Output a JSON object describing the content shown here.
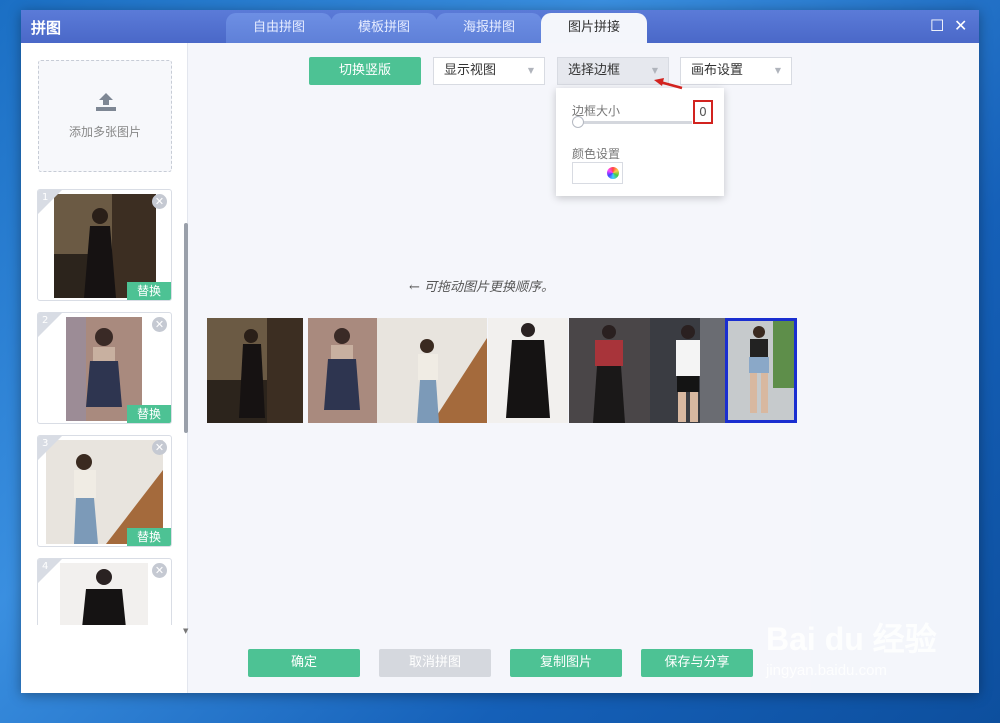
{
  "window": {
    "title": "拼图"
  },
  "tabs": [
    {
      "label": "自由拼图"
    },
    {
      "label": "模板拼图"
    },
    {
      "label": "海报拼图"
    },
    {
      "label": "图片拼接"
    }
  ],
  "window_controls": {
    "maximize": "☐",
    "close": "✕"
  },
  "sidebar": {
    "add_label": "添加多张图片",
    "thumbnails": [
      {
        "index": "1",
        "replace": "替换"
      },
      {
        "index": "2",
        "replace": "替换"
      },
      {
        "index": "3",
        "replace": "替换"
      },
      {
        "index": "4",
        "replace": "替换"
      }
    ]
  },
  "toolbar": {
    "switch_label": "切换竖版",
    "view_label": "显示视图",
    "border_label": "选择边框",
    "canvas_label": "画布设置"
  },
  "border_popup": {
    "size_label": "边框大小",
    "size_value": "0",
    "color_label": "颜色设置"
  },
  "hint": "← 可拖动图片更换顺序。",
  "bottom": {
    "confirm": "确定",
    "cancel": "取消拼图",
    "copy": "复制图片",
    "save": "保存与分享"
  },
  "watermark": {
    "brand": "Bai du 经验",
    "url": "jingyan.baidu.com"
  },
  "colors": {
    "accent_green": "#4dc294",
    "titlebar": "#4a68c8",
    "highlight_red": "#d2231f",
    "selected_blue": "#1a2ed0"
  }
}
